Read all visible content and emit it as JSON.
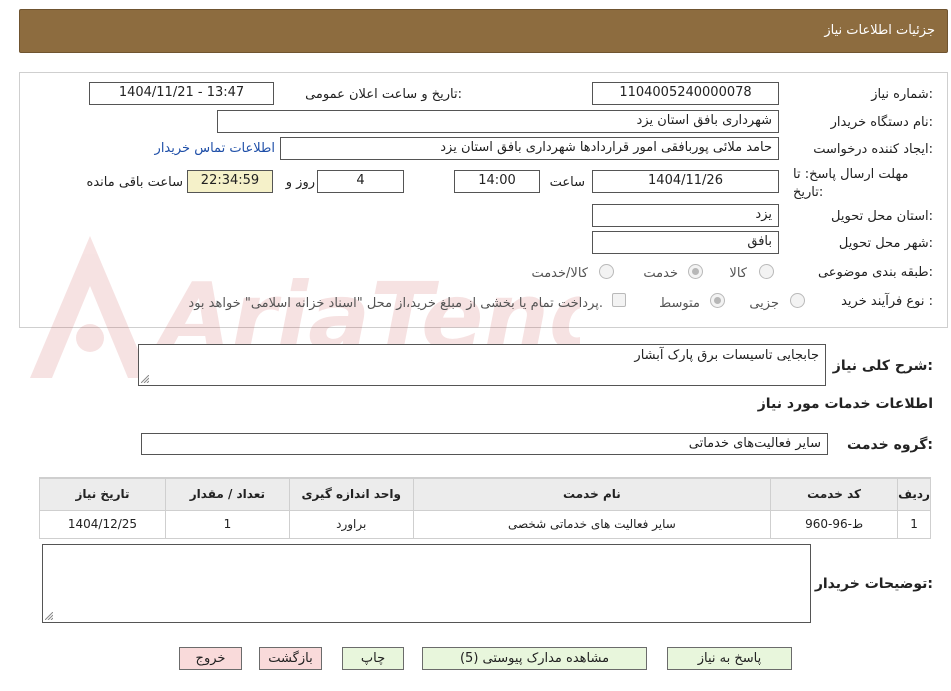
{
  "header": {
    "title": "جزئیات اطلاعات نیاز"
  },
  "form": {
    "need_number_label": "شماره نیاز:",
    "need_number": "1104005240000078",
    "announce_label": "تاریخ و ساعت اعلان عمومی:",
    "announce_value": "1404/11/21 - 13:47",
    "buyer_org_label": "نام دستگاه خریدار:",
    "buyer_org": "شهرداری بافق استان یزد",
    "requester_label": "ایجاد کننده درخواست:",
    "requester": "حامد ملائی پوربافقی امور قراردادها شهرداری بافق استان یزد",
    "contact_link": "اطلاعات تماس خریدار",
    "deadline_label": "مهلت ارسال پاسخ: تا تاریخ:",
    "deadline_date": "1404/11/26",
    "time_word": "ساعت",
    "deadline_time": "14:00",
    "days_value": "4",
    "days_word": "روز و",
    "remaining_time": "22:34:59",
    "remaining_word": "ساعت باقی مانده",
    "province_label": "استان محل تحویل:",
    "province": "یزد",
    "city_label": "شهر محل تحویل:",
    "city": "بافق",
    "category_label": "طبقه بندی موضوعی:",
    "category_options": [
      "کالا",
      "خدمت",
      "کالا/خدمت"
    ],
    "process_label": "نوع فرآیند خرید :",
    "process_options": [
      "جزیی",
      "متوسط"
    ],
    "payment_note": "پرداخت تمام یا بخشی از مبلغ خرید،از محل \"اسناد خزانه اسلامی\" خواهد بود."
  },
  "summary": {
    "label": "شرح کلی نیاز:",
    "value": "جابجایی تاسیسات برق پارک آبشار"
  },
  "services": {
    "section_title": "اطلاعات خدمات مورد نیاز",
    "group_label": "گروه خدمت:",
    "group_value": "سایر فعالیت‌های خدماتی"
  },
  "table": {
    "headers": [
      "ردیف",
      "کد خدمت",
      "نام خدمت",
      "واحد اندازه گیری",
      "تعداد / مقدار",
      "تاریخ نیاز"
    ],
    "rows": [
      [
        "1",
        "ط-96-960",
        "سایر فعالیت های خدماتی شخصی",
        "براورد",
        "1",
        "1404/12/25"
      ]
    ]
  },
  "notes": {
    "label": "توضیحات خریدار:"
  },
  "buttons": {
    "reply": "پاسخ به نیاز",
    "attachments": "مشاهده مدارک پیوستی (5)",
    "print": "چاپ",
    "back": "بازگشت",
    "exit": "خروج"
  },
  "watermark_text": "AriaTender.neT",
  "colors": {
    "header_bg": "#8d6c3f",
    "time_bg": "#f5f1c9",
    "link": "#1f4fa8",
    "button_green": "#e8f6dc",
    "button_pink": "#f9dada"
  }
}
